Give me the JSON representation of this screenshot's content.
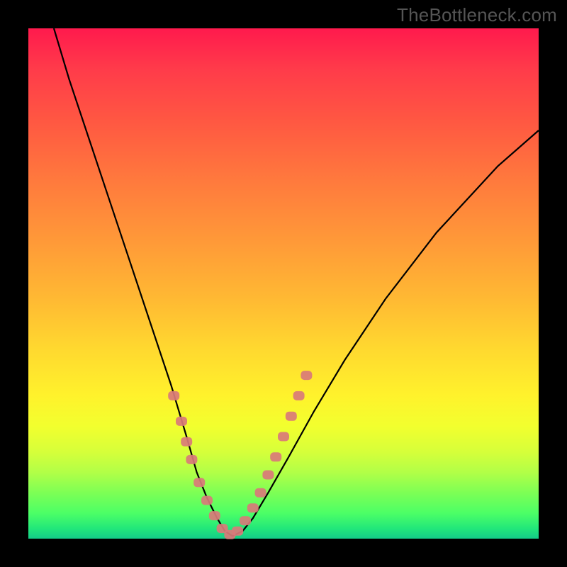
{
  "watermark": "TheBottleneck.com",
  "chart_data": {
    "type": "line",
    "title": "",
    "xlabel": "",
    "ylabel": "",
    "xlim": [
      0,
      100
    ],
    "ylim": [
      0,
      100
    ],
    "grid": false,
    "legend": false,
    "background_gradient": [
      "#ff1a4d",
      "#ffd92f",
      "#14cc88"
    ],
    "series": [
      {
        "name": "bottleneck-curve",
        "color": "#000000",
        "x": [
          5,
          8,
          12,
          16,
          20,
          24,
          28,
          31,
          33,
          35,
          37,
          38.5,
          40,
          42,
          44,
          47,
          51,
          56,
          62,
          70,
          80,
          92,
          100
        ],
        "y": [
          100,
          90,
          78,
          66,
          54,
          42,
          30,
          20,
          13,
          8,
          4,
          1.5,
          0.5,
          1.5,
          4,
          9,
          16,
          25,
          35,
          47,
          60,
          73,
          80
        ]
      }
    ],
    "highlight_points": {
      "name": "marker-dots",
      "color": "#d97a7a",
      "x": [
        28.5,
        30,
        31,
        32,
        33.5,
        35,
        36.5,
        38,
        39.5,
        41,
        42.5,
        44,
        45.5,
        47,
        48.5,
        50,
        51.5,
        53,
        54.5
      ],
      "y": [
        28,
        23,
        19,
        15.5,
        11,
        7.5,
        4.5,
        2,
        0.8,
        1.5,
        3.5,
        6,
        9,
        12.5,
        16,
        20,
        24,
        28,
        32
      ]
    }
  }
}
